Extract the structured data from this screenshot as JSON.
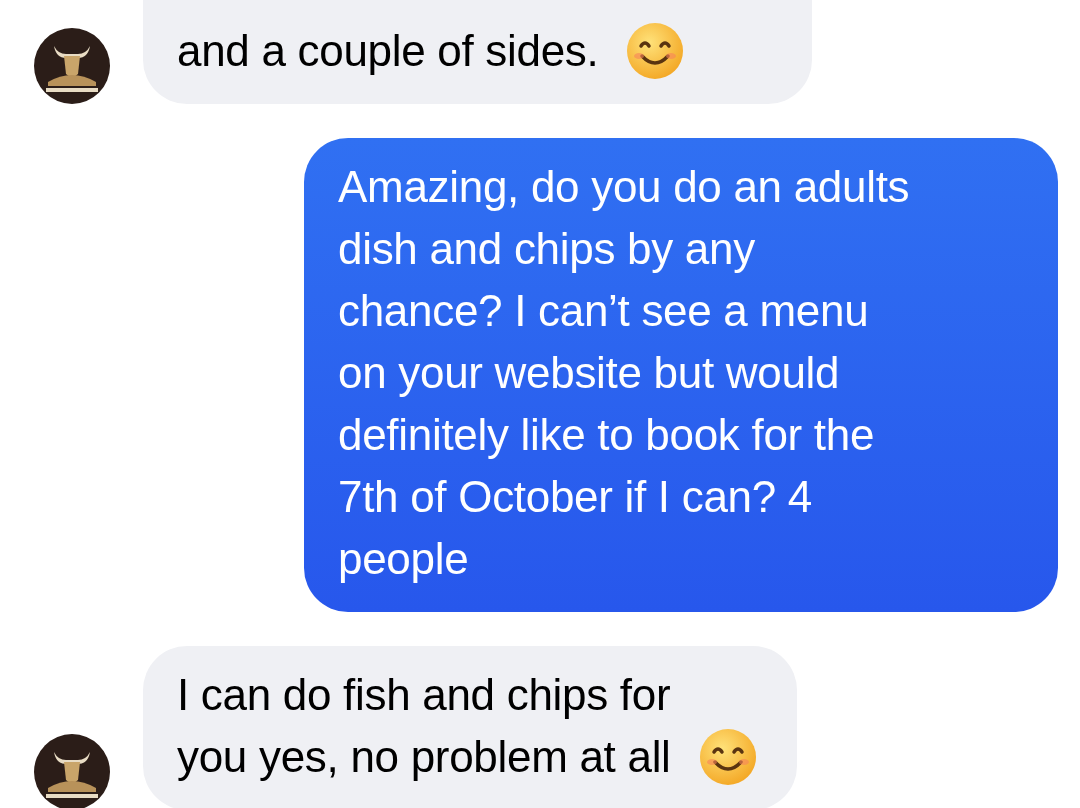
{
  "messages": [
    {
      "kind": "received",
      "lines": [
        "and a couple of sides."
      ],
      "emoji": true
    },
    {
      "kind": "sent",
      "lines": [
        "Amazing, do you do an adults",
        "dish and chips by any",
        "chance? I can’t see a menu",
        "on your website but would",
        "definitely like to book for the",
        "7th of October if I can? 4",
        "people"
      ],
      "emoji": false
    },
    {
      "kind": "received",
      "lines": [
        "I can do fish and chips for",
        "you yes, no problem at all"
      ],
      "emoji": true
    }
  ]
}
